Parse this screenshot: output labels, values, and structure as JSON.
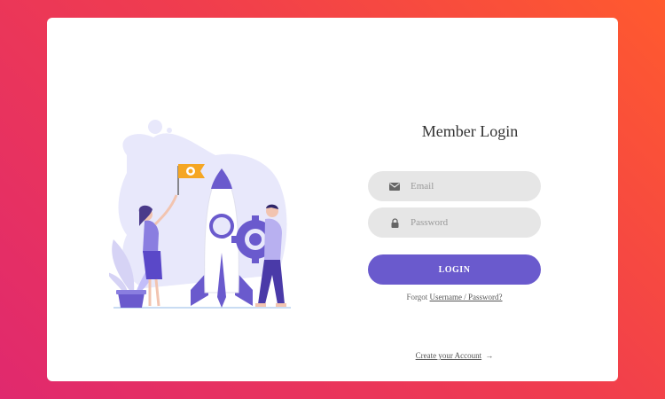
{
  "login": {
    "title": "Member Login",
    "email_placeholder": "Email",
    "password_placeholder": "Password",
    "login_button": "LOGIN",
    "forgot_prefix": "Forgot",
    "forgot_link": "Username / Password?",
    "create_account": "Create your Account",
    "create_arrow": "→"
  },
  "icons": {
    "email": "envelope-icon",
    "password": "lock-icon"
  },
  "colors": {
    "gradient_start": "#e0296e",
    "gradient_end": "#ff5a2e",
    "button": "#6a5acd",
    "input_bg": "#e6e6e6",
    "accent_flag": "#f5a623"
  }
}
